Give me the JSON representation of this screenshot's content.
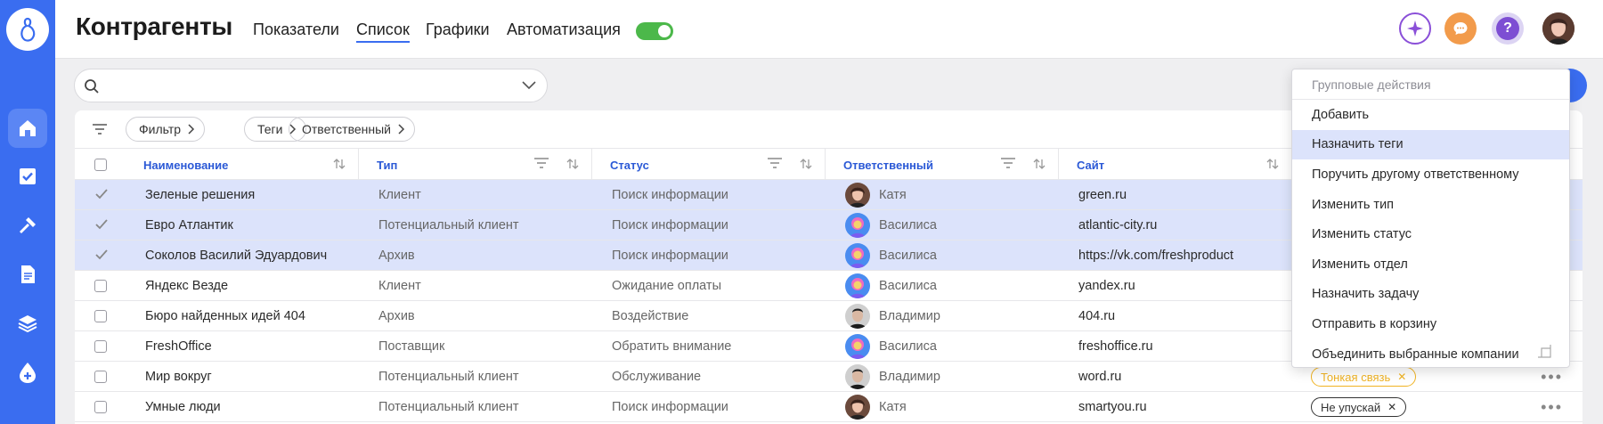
{
  "header": {
    "title": "Контрагенты",
    "tabs": [
      {
        "label": "Показатели"
      },
      {
        "label": "Список"
      },
      {
        "label": "Графики"
      },
      {
        "label": "Автоматизация"
      }
    ],
    "active_tab": "Список",
    "automation_toggle": true
  },
  "sidebar": {
    "items": [
      {
        "icon": "home-icon",
        "active": true
      },
      {
        "icon": "checkbox-icon",
        "active": false
      },
      {
        "icon": "hammer-icon",
        "active": false
      },
      {
        "icon": "document-icon",
        "active": false
      },
      {
        "icon": "layers-icon",
        "active": false
      },
      {
        "icon": "drop-plus-icon",
        "active": false
      }
    ]
  },
  "search": {
    "placeholder": ""
  },
  "filters": {
    "chips": [
      {
        "label": "Фильтр"
      },
      {
        "label": "Теги"
      },
      {
        "label": "Ответственный"
      }
    ]
  },
  "table": {
    "columns": [
      {
        "label": "Наименование"
      },
      {
        "label": "Тип"
      },
      {
        "label": "Статус"
      },
      {
        "label": "Ответственный"
      },
      {
        "label": "Сайт"
      }
    ],
    "rows": [
      {
        "name": "Зеленые решения",
        "type": "Клиент",
        "status": "Поиск информации",
        "owner": "Катя",
        "avatar": "katya",
        "site": "green.ru",
        "selected": true
      },
      {
        "name": "Евро Атлантик",
        "type": "Потенциальный клиент",
        "status": "Поиск информации",
        "owner": "Василиса",
        "avatar": "vasilisa",
        "site": "atlantic-city.ru",
        "selected": true
      },
      {
        "name": "Соколов Василий Эдуардович",
        "type": "Архив",
        "status": "Поиск информации",
        "owner": "Василиса",
        "avatar": "vasilisa",
        "site": "https://vk.com/freshproduct",
        "selected": true
      },
      {
        "name": "Яндекс Везде",
        "type": "Клиент",
        "status": "Ожидание оплаты",
        "owner": "Василиса",
        "avatar": "vasilisa",
        "site": "yandex.ru",
        "selected": false
      },
      {
        "name": "Бюро найденных идей 404",
        "type": "Архив",
        "status": "Воздействие",
        "owner": "Владимир",
        "avatar": "vladimir",
        "site": "404.ru",
        "selected": false
      },
      {
        "name": "FreshOffice",
        "type": "Поставщик",
        "status": "Обратить внимание",
        "owner": "Василиса",
        "avatar": "vasilisa",
        "site": "freshoffice.ru",
        "selected": false
      },
      {
        "name": "Мир вокруг",
        "type": "Потенциальный клиент",
        "status": "Обслуживание",
        "owner": "Владимир",
        "avatar": "vladimir",
        "site": "word.ru",
        "selected": false,
        "tag": {
          "label": "Тонкая связь",
          "color": "#f0b323"
        }
      },
      {
        "name": "Умные люди",
        "type": "Потенциальный клиент",
        "status": "Поиск информации",
        "owner": "Катя",
        "avatar": "katya",
        "site": "smartyou.ru",
        "selected": false,
        "tag": {
          "label": "Не упускай",
          "color": "#333333"
        }
      }
    ]
  },
  "menu": {
    "title": "Групповые действия",
    "items": [
      {
        "label": "Добавить"
      },
      {
        "label": "Назначить теги",
        "hover": true
      },
      {
        "label": "Поручить другому ответственному"
      },
      {
        "label": "Изменить тип"
      },
      {
        "label": "Изменить статус"
      },
      {
        "label": "Изменить отдел"
      },
      {
        "label": "Назначить задачу"
      },
      {
        "label": "Отправить в корзину"
      },
      {
        "label": "Объединить выбранные компании"
      }
    ]
  },
  "colors": {
    "accent": "#3a6df0",
    "selected_row": "#dce3fb",
    "toggle_on": "#4cb84a"
  }
}
